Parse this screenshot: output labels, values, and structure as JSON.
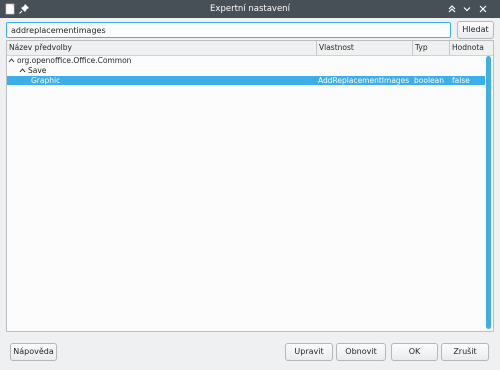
{
  "window": {
    "title": "Expertní nastavení"
  },
  "search": {
    "value": "addreplacementimages",
    "button_label": "Hledat"
  },
  "table": {
    "columns": [
      "Název předvolby",
      "Vlastnost",
      "Typ",
      "Hodnota"
    ],
    "tree": {
      "root_label": "org.openoffice.Office.Common",
      "group_label": "Save",
      "item": {
        "name": "Graphic",
        "property": "AddReplacementImages",
        "type": "boolean",
        "value": "false"
      }
    }
  },
  "buttons": {
    "help": "Nápověda",
    "edit": "Upravit",
    "default": "Obnovit",
    "ok": "OK",
    "cancel": "Zrušit"
  },
  "colors": {
    "titlebar": "#475057",
    "selection": "#3daee9",
    "window_bg": "#eff0f1"
  }
}
